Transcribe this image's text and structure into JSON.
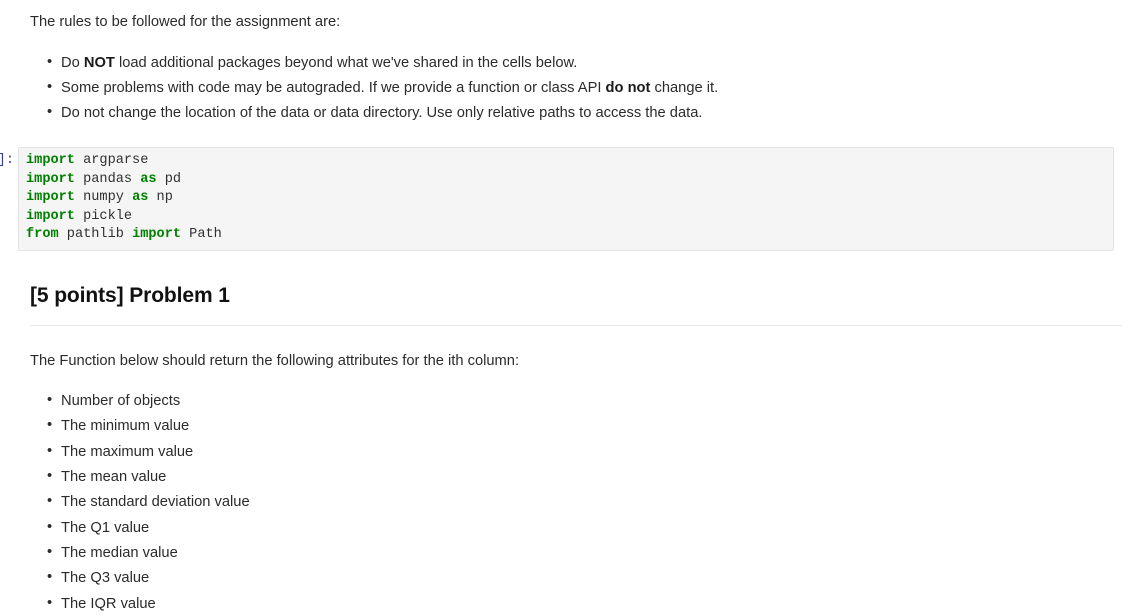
{
  "intro": {
    "paragraph": "The rules to be followed for the assignment are:",
    "rules": [
      {
        "pre": "Do ",
        "bold": "NOT",
        "post": " load additional packages beyond what we've shared in the cells below."
      },
      {
        "pre": "Some problems with code may be autograded. If we provide a function or class API ",
        "bold": "do not",
        "post": " change it."
      },
      {
        "pre": "Do not change the location of the data or data directory. Use only relative paths to access the data.",
        "bold": "",
        "post": ""
      }
    ]
  },
  "code_cell": {
    "prompt": "]:",
    "lines": [
      {
        "keyword": "import",
        "rest": " argparse",
        "keyword2": "",
        "rest2": ""
      },
      {
        "keyword": "import",
        "rest": " pandas ",
        "keyword2": "as",
        "rest2": " pd"
      },
      {
        "keyword": "import",
        "rest": " numpy ",
        "keyword2": "as",
        "rest2": " np"
      },
      {
        "keyword": "import",
        "rest": " pickle",
        "keyword2": "",
        "rest2": ""
      },
      {
        "keyword": "from",
        "rest": " pathlib ",
        "keyword2": "import",
        "rest2": " Path"
      }
    ]
  },
  "problem": {
    "heading": "[5 points] Problem 1",
    "description": "The Function below should return the following attributes for the ith column:",
    "attributes": [
      "Number of objects",
      "The minimum value",
      "The maximum value",
      "The mean value",
      "The standard deviation value",
      "The Q1 value",
      "The median value",
      "The Q3 value",
      "The IQR value"
    ]
  },
  "colors": {
    "keyword": "#008000",
    "code_background": "#f5f5f5",
    "code_border": "#e3e3e3",
    "prompt": "#303f9f",
    "text": "#2b2b2b",
    "rule": "#e8e8e8"
  }
}
